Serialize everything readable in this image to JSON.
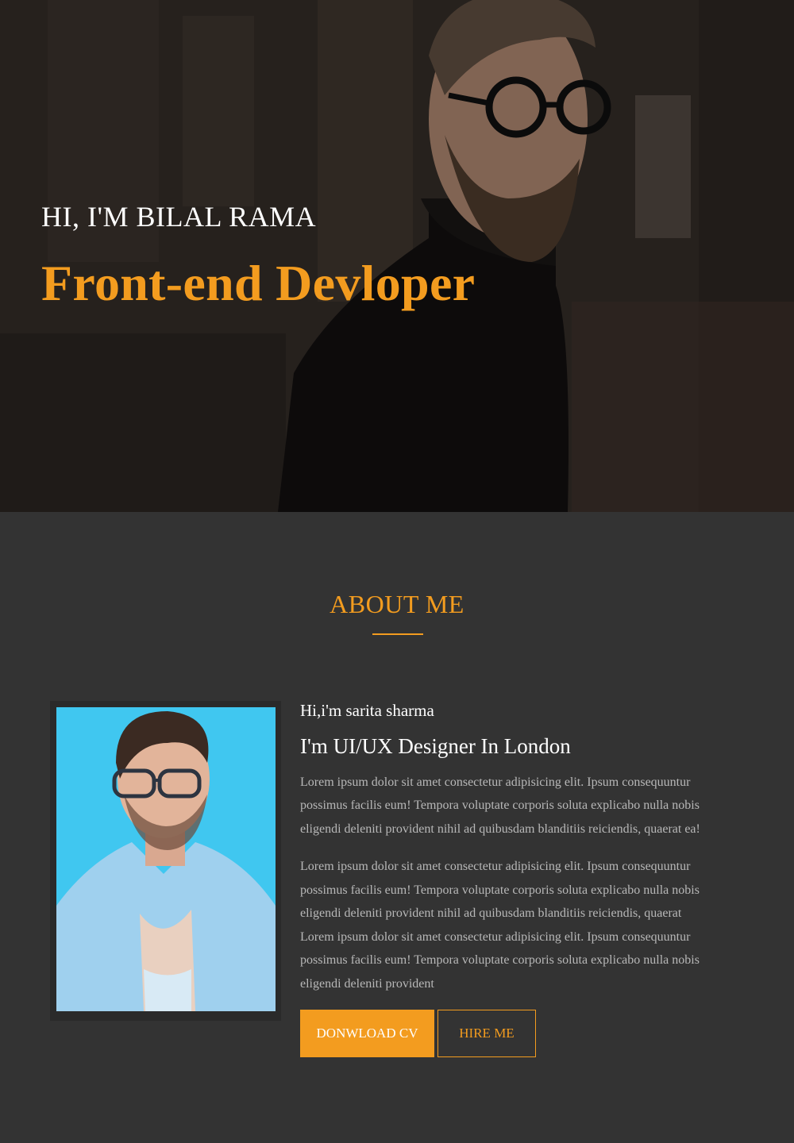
{
  "hero": {
    "greeting": "HI, I'M BILAL RAMA",
    "title": "Front-end Devloper"
  },
  "about": {
    "heading": "ABOUT ME",
    "intro": "Hi,i'm sarita sharma",
    "role": "I'm UI/UX Designer In London",
    "paragraph_1": "Lorem ipsum dolor sit amet consectetur adipisicing elit. Ipsum consequuntur possimus facilis eum! Tempora voluptate corporis soluta explicabo nulla nobis eligendi deleniti provident nihil ad quibusdam blanditiis reiciendis, quaerat ea!",
    "paragraph_2": "Lorem ipsum dolor sit amet consectetur adipisicing elit. Ipsum consequuntur possimus facilis eum! Tempora voluptate corporis soluta explicabo nulla nobis eligendi deleniti provident nihil ad quibusdam blanditiis reiciendis, quaerat Lorem ipsum dolor sit amet consectetur adipisicing elit. Ipsum consequuntur possimus facilis eum! Tempora voluptate corporis soluta explicabo nulla nobis eligendi deleniti provident",
    "download_label": "DONWLOAD CV",
    "hire_label": "HIRE ME"
  },
  "colors": {
    "accent": "#f39c1f",
    "background": "#333333",
    "photo_backdrop": "#3cc3ee"
  }
}
